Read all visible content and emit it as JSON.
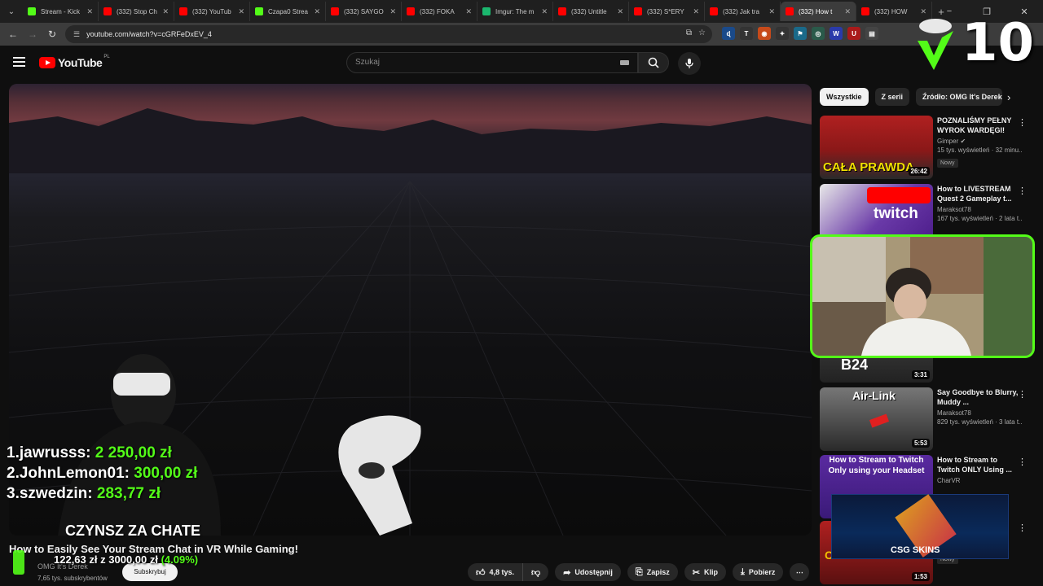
{
  "browser": {
    "tabs": [
      {
        "title": "Stream - Kick",
        "color": "#53fc18",
        "active": false
      },
      {
        "title": "(332) Stop Ch",
        "color": "#ff0000",
        "active": false
      },
      {
        "title": "(332) YouTub",
        "color": "#ff0000",
        "active": false
      },
      {
        "title": "Czapa0 Strea",
        "color": "#53fc18",
        "active": false
      },
      {
        "title": "(332) SAYGO",
        "color": "#ff0000",
        "active": false
      },
      {
        "title": "(332) FOKA",
        "color": "#ff0000",
        "active": false
      },
      {
        "title": "Imgur: The m",
        "color": "#1bb76e",
        "active": false
      },
      {
        "title": "(332) Untitle",
        "color": "#ff0000",
        "active": false
      },
      {
        "title": "(332) S*ERY",
        "color": "#ff0000",
        "active": false
      },
      {
        "title": "(332) Jak tra",
        "color": "#ff0000",
        "active": false
      },
      {
        "title": "(332) How t",
        "color": "#ff0000",
        "active": true
      },
      {
        "title": "(332) HOW",
        "color": "#ff0000",
        "active": false
      }
    ],
    "new_tab": "+",
    "url": "youtube.com/watch?v=cGRFeDxEV_4",
    "window_controls": [
      "−",
      "❐",
      "✕"
    ]
  },
  "youtube": {
    "logo_text": "YouTube",
    "country": "PL",
    "search_placeholder": "Szukaj"
  },
  "stream_overlay": {
    "donors": [
      {
        "rank": "1.",
        "name": "jawrusss:",
        "amount": "2 250,00 zł"
      },
      {
        "rank": "2.",
        "name": "JohnLemon01:",
        "amount": "300,00 zł"
      },
      {
        "rank": "3.",
        "name": "szwedzin:",
        "amount": "283,77 zł"
      }
    ],
    "goal_title": "CZYNSZ ZA CHATE",
    "goal_current": "122,63 zł",
    "goal_sep": "z",
    "goal_target": "3000,00 zł",
    "goal_pct": "(4.09%)",
    "counter": "10",
    "csgo_label": "CSG SKINS",
    "accent": "#53fc18"
  },
  "video": {
    "title": "How to Easily See Your Stream Chat in VR While Gaming!",
    "channel": "OMG It's Derek",
    "subscribers": "7,65 tys. subskrybentów",
    "subscribe_label": "Subskrybuj",
    "likes": "4,8 tys.",
    "share_label": "Udostępnij",
    "save_label": "Zapisz",
    "clip_label": "Klip",
    "download_label": "Pobierz",
    "more_label": "⋯"
  },
  "sidebar": {
    "chips": [
      "Wszystkie",
      "Z serii",
      "Źródło: OMG It's Derek"
    ],
    "recommendations": [
      {
        "title": "POZNALIŚMY PEŁNY WYROK WARDĘGI!",
        "channel": "Gimper",
        "views": "15 tys. wyświetleń · 32 minu...",
        "badge": "Nowy",
        "duration": "26:42",
        "thumb_text": "CAŁA PRAWDA"
      },
      {
        "title": "How to LIVESTREAM Quest 2 Gameplay t...",
        "channel": "Maraksot78",
        "views": "167 tys. wyświetleń · 2 lata t...",
        "badge": "",
        "duration": "",
        "thumb_text": "twitch"
      },
      {
        "title": "",
        "channel": "",
        "views": "",
        "badge": "",
        "duration": "3:31",
        "thumb_text": "B24"
      },
      {
        "title": "Say Goodbye to Blurry, Muddy ...",
        "channel": "Maraksot78",
        "views": "829 tys. wyświetleń · 3 lata t...",
        "badge": "",
        "duration": "5:53",
        "thumb_text": "Air-Link"
      },
      {
        "title": "How to Stream to Twitch ONLY Using ...",
        "channel": "CharVR",
        "views": "",
        "badge": "",
        "duration": "",
        "thumb_text": "How to Stream to Twitch Only using your Headset"
      },
      {
        "title": "",
        "channel": "",
        "views": "",
        "badge": "Nowy",
        "duration": "1:53",
        "thumb_text": "CRY"
      }
    ]
  }
}
